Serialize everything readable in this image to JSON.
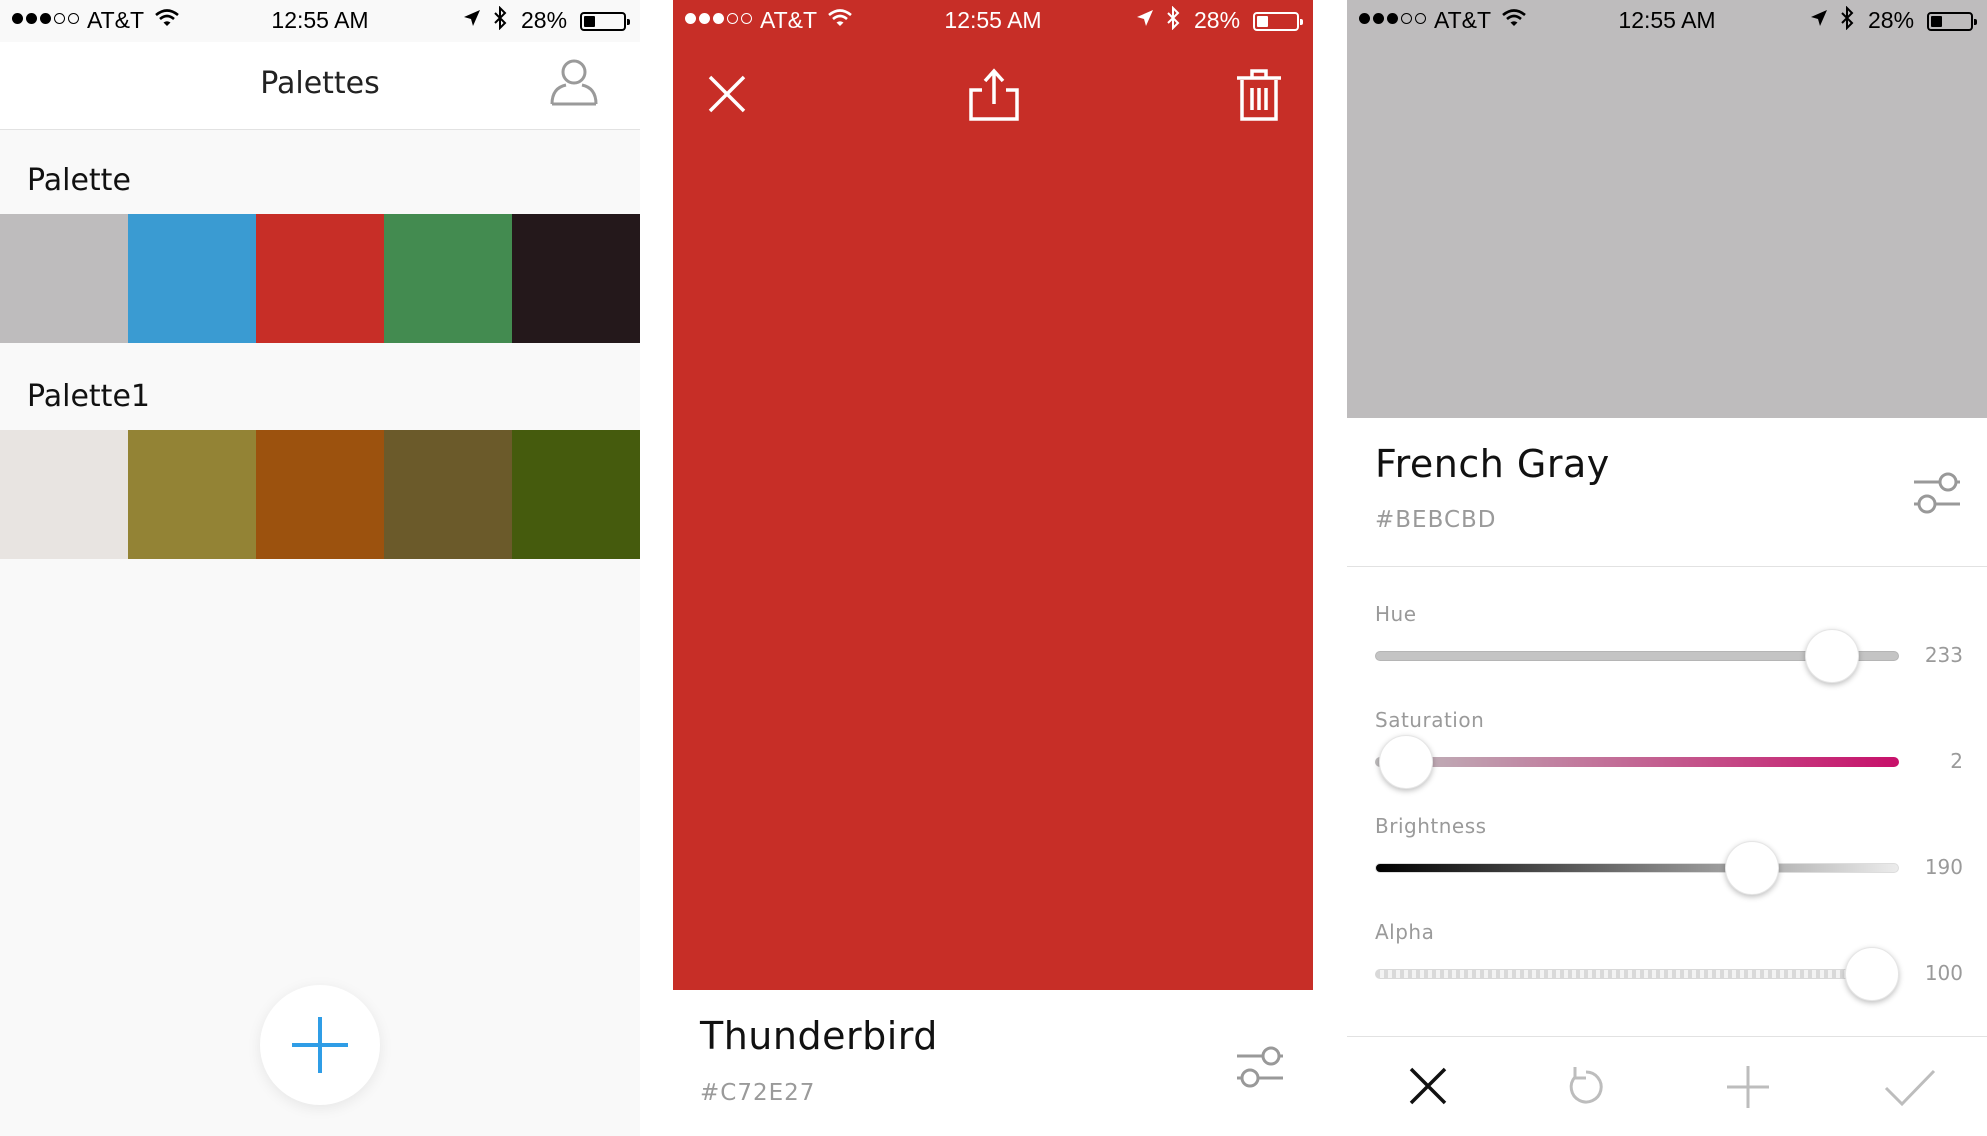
{
  "status_bar": {
    "carrier": "AT&T",
    "time": "12:55 AM",
    "battery": "28%",
    "battery_level": 0.28
  },
  "palettes_screen": {
    "title": "Palettes",
    "palettes": [
      {
        "name": "Palette",
        "colors": [
          "#bebcbd",
          "#3a9bd2",
          "#c72e27",
          "#438b50",
          "#24181b"
        ]
      },
      {
        "name": "Palette1",
        "colors": [
          "#e8e4e1",
          "#938335",
          "#9c520e",
          "#6b5a2a",
          "#455b0d"
        ]
      }
    ],
    "icons": {
      "profile": "person-icon",
      "add": "plus-icon"
    },
    "accent_color": "#2f9de6"
  },
  "color_detail_screen": {
    "color_name": "Thunderbird",
    "hex": "#C72E27",
    "swatch_color": "#c72e27",
    "icons": {
      "close": "close-icon",
      "share": "share-icon",
      "delete": "trash-icon",
      "adjust": "sliders-icon"
    }
  },
  "color_edit_screen": {
    "color_name": "French Gray",
    "hex": "#BEBCBD",
    "swatch_color": "#bebcbd",
    "sliders": [
      {
        "label": "Hue",
        "value": "233"
      },
      {
        "label": "Saturation",
        "value": "2"
      },
      {
        "label": "Brightness",
        "value": "190"
      },
      {
        "label": "Alpha",
        "value": "100"
      }
    ],
    "saturation_color": "#c7106a",
    "icons": {
      "cancel": "close-icon",
      "reset": "undo-icon",
      "add": "plus-icon",
      "confirm": "checkmark-icon",
      "adjust": "sliders-icon"
    }
  }
}
